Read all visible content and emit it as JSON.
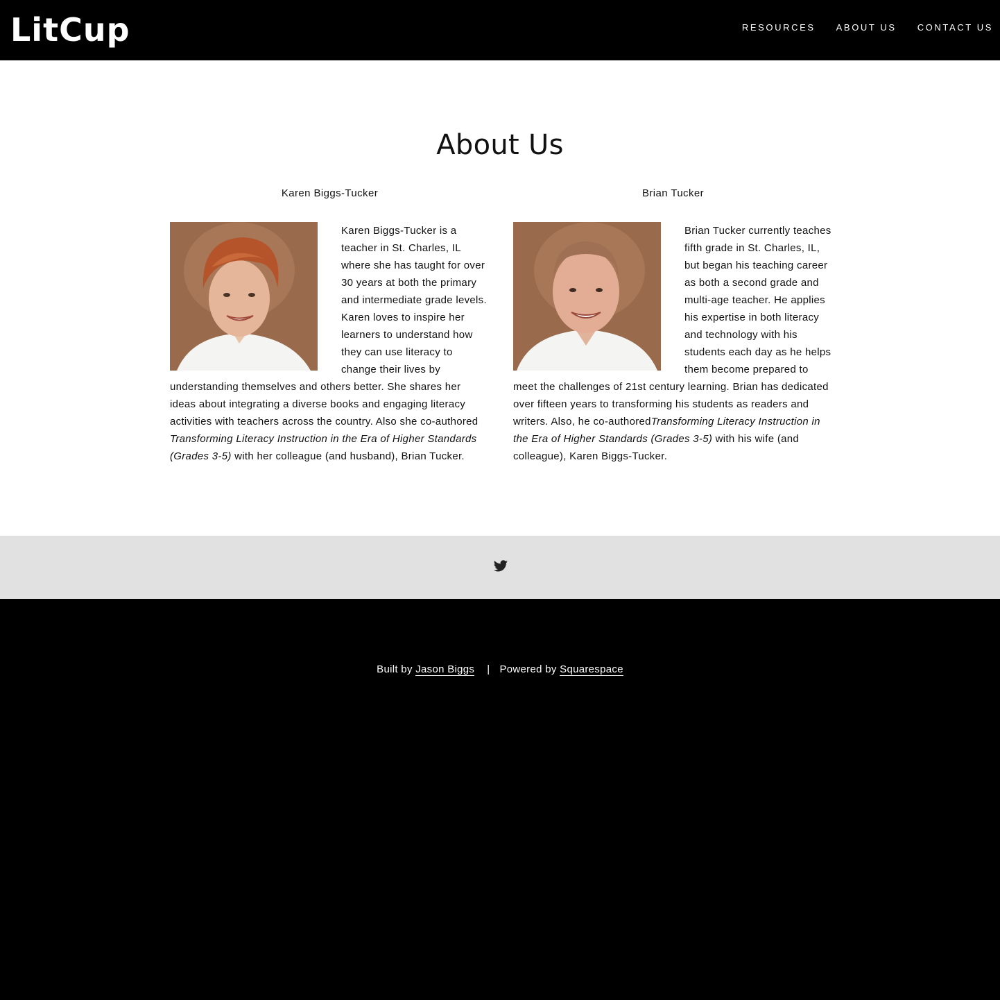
{
  "header": {
    "logo": "LitCup",
    "nav": [
      "RESOURCES",
      "ABOUT US",
      "CONTACT US"
    ]
  },
  "main": {
    "title": "About Us",
    "people": [
      {
        "name": "Karen Biggs-Tucker",
        "bio_text": "Karen Biggs-Tucker is a teacher in St. Charles, IL where she has taught for over 30 years at both the primary and intermediate grade levels. Karen loves to inspire her learners to understand how they can use literacy to change their lives by understanding themselves and others better. She shares her ideas about integrating a diverse books and engaging literacy activities with teachers across the country. Also she co-authored ",
        "book_title": "Transforming Literacy Instruction in the Era of Higher Standards (Grades 3-5)",
        "bio_tail": " with her colleague (and husband), Brian Tucker."
      },
      {
        "name": "Brian Tucker",
        "bio_text": "Brian Tucker currently teaches fifth grade in St. Charles, IL, but began his teaching career as both a second grade and multi-age teacher. He applies his expertise in both literacy and technology with his students each day as he helps them become prepared to meet the challenges of 21st century learning. Brian has dedicated over fifteen years to transforming his students as readers and writers. Also, he co-authored",
        "book_title": "Transforming Literacy Instruction in the Era of Higher Standards (Grades 3-5)",
        "bio_tail": " with his wife (and colleague), Karen Biggs-Tucker."
      }
    ]
  },
  "social": {
    "icon": "twitter-icon"
  },
  "footer": {
    "built_prefix": "Built by ",
    "built_link": "Jason Biggs",
    "separator": "|",
    "powered_prefix": "Powered by ",
    "powered_link": "Squarespace"
  },
  "colors": {
    "header_bg": "#000000",
    "social_bg": "#e1e1e1",
    "text": "#111111"
  }
}
